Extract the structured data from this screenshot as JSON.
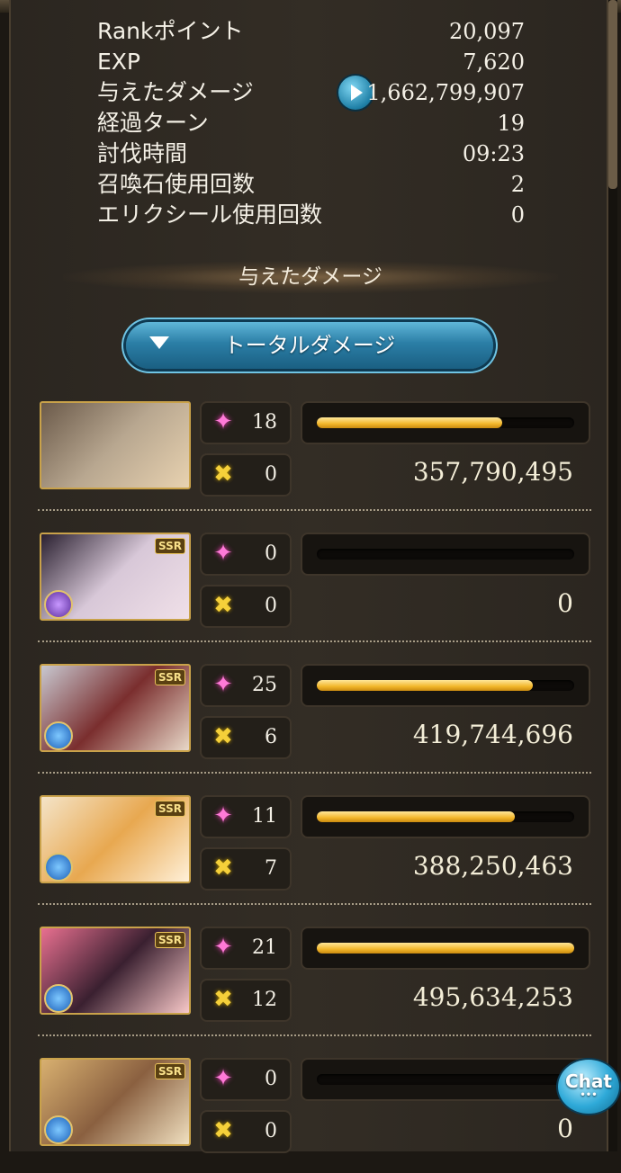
{
  "summary": [
    {
      "label": "Rankポイント",
      "value": "20,097"
    },
    {
      "label": "EXP",
      "value": "7,620"
    },
    {
      "label": "与えたダメージ",
      "value": "1,662,799,907"
    },
    {
      "label": "経過ターン",
      "value": "19"
    },
    {
      "label": "討伐時間",
      "value": "09:23"
    },
    {
      "label": "召喚石使用回数",
      "value": "2"
    },
    {
      "label": "エリクシール使用回数",
      "value": "0"
    }
  ],
  "section_title": "与えたダメージ",
  "dropdown": {
    "label": "トータルダメージ"
  },
  "characters": [
    {
      "rarity": "",
      "element": "",
      "skills": "18",
      "buffs": "0",
      "damage": "357,790,495",
      "bar_fraction": 0.72,
      "portrait_colors": [
        "#6b5a4a",
        "#b8a790",
        "#e8d2b0"
      ]
    },
    {
      "rarity": "SSR",
      "element": "dark",
      "skills": "0",
      "buffs": "0",
      "damage": "0",
      "bar_fraction": 0,
      "portrait_colors": [
        "#2a2030",
        "#d8c8d8",
        "#f0e0e8"
      ]
    },
    {
      "rarity": "SSR",
      "element": "water",
      "skills": "25",
      "buffs": "6",
      "damage": "419,744,696",
      "bar_fraction": 0.84,
      "portrait_colors": [
        "#c8c8d0",
        "#7a2e2e",
        "#e8d8c8"
      ]
    },
    {
      "rarity": "SSR",
      "element": "water",
      "skills": "11",
      "buffs": "7",
      "damage": "388,250,463",
      "bar_fraction": 0.77,
      "portrait_colors": [
        "#f4e4c8",
        "#e8a850",
        "#fff0d8"
      ]
    },
    {
      "rarity": "SSR",
      "element": "water",
      "skills": "21",
      "buffs": "12",
      "damage": "495,634,253",
      "bar_fraction": 1.0,
      "portrait_colors": [
        "#e87090",
        "#3a2030",
        "#f8c8c8"
      ]
    },
    {
      "rarity": "SSR",
      "element": "water",
      "skills": "0",
      "buffs": "0",
      "damage": "0",
      "bar_fraction": 0,
      "portrait_colors": [
        "#d8b070",
        "#8a6040",
        "#f0e0c0"
      ]
    }
  ],
  "chat": {
    "label": "Chat"
  },
  "icons": {
    "skill": "skill-sparkle-icon",
    "buff": "buff-crossed-icon",
    "play": "play-icon",
    "dropdown": "chevron-down-icon"
  },
  "colors": {
    "bar_fill": "#f2b62a",
    "accent_blue": "#2b7ea6"
  }
}
